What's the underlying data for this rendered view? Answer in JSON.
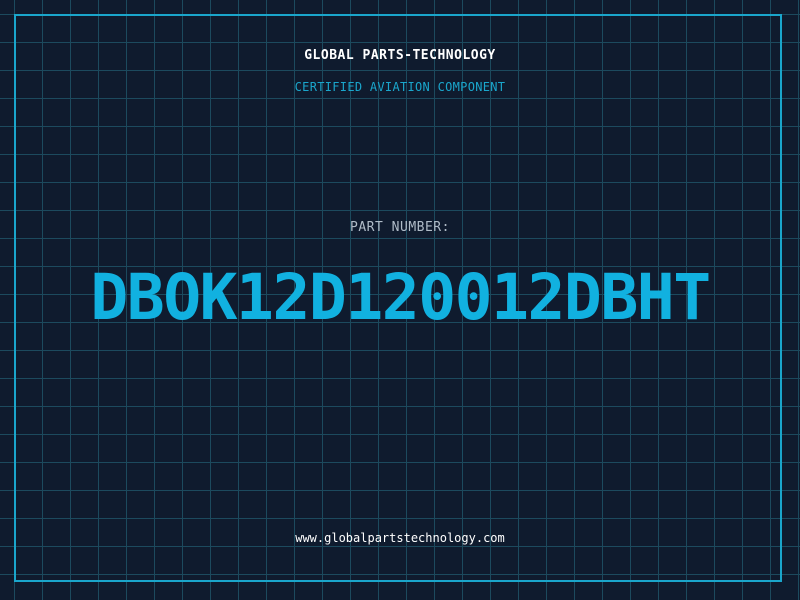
{
  "header": {
    "brand": "GLOBAL PARTS-TECHNOLOGY",
    "subtitle": "CERTIFIED AVIATION COMPONENT"
  },
  "part": {
    "label": "PART NUMBER:",
    "number": "DBOK12D120012DBHT"
  },
  "footer": {
    "website": "www.globalpartstechnology.com"
  },
  "colors": {
    "background": "#0f1b2e",
    "grid": "#1c4a5e",
    "accent": "#1aa6cc",
    "part_number": "#11b1e0",
    "text": "#ffffff"
  }
}
